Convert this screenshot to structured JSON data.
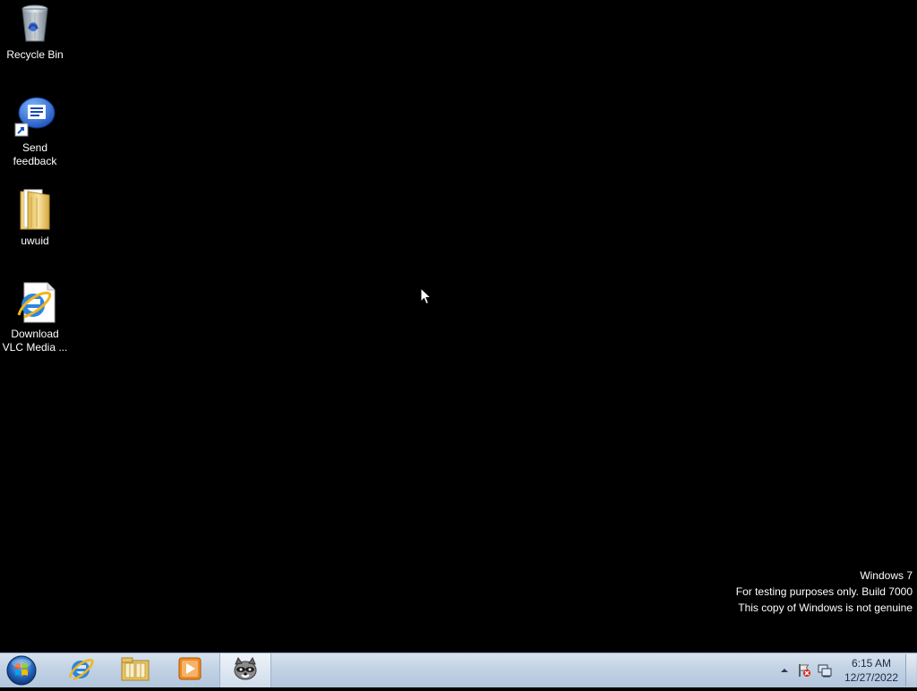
{
  "desktop": {
    "icons": [
      {
        "label": "Recycle Bin",
        "icon": "recycle-bin-icon"
      },
      {
        "label": "Send feedback",
        "icon": "feedback-icon"
      },
      {
        "label": "uwuid",
        "icon": "folder-icon"
      },
      {
        "label": "Download VLC Media ...",
        "icon": "internet-explorer-icon"
      }
    ]
  },
  "watermark": {
    "line1": "Windows  7",
    "line2": "For testing purposes only. Build 7000",
    "line3": "This copy of Windows is not genuine"
  },
  "taskbar": {
    "pinned": [
      {
        "icon": "internet-explorer-icon"
      },
      {
        "icon": "windows-explorer-icon"
      },
      {
        "icon": "media-player-icon"
      },
      {
        "icon": "raccoon-app-icon",
        "active": true
      }
    ],
    "tray": {
      "time": "6:15 AM",
      "date": "12/27/2022"
    }
  },
  "colors": {
    "desktop_bg": "#000000",
    "taskbar_bg": "#c2d2e4",
    "text_light": "#ffffff"
  }
}
